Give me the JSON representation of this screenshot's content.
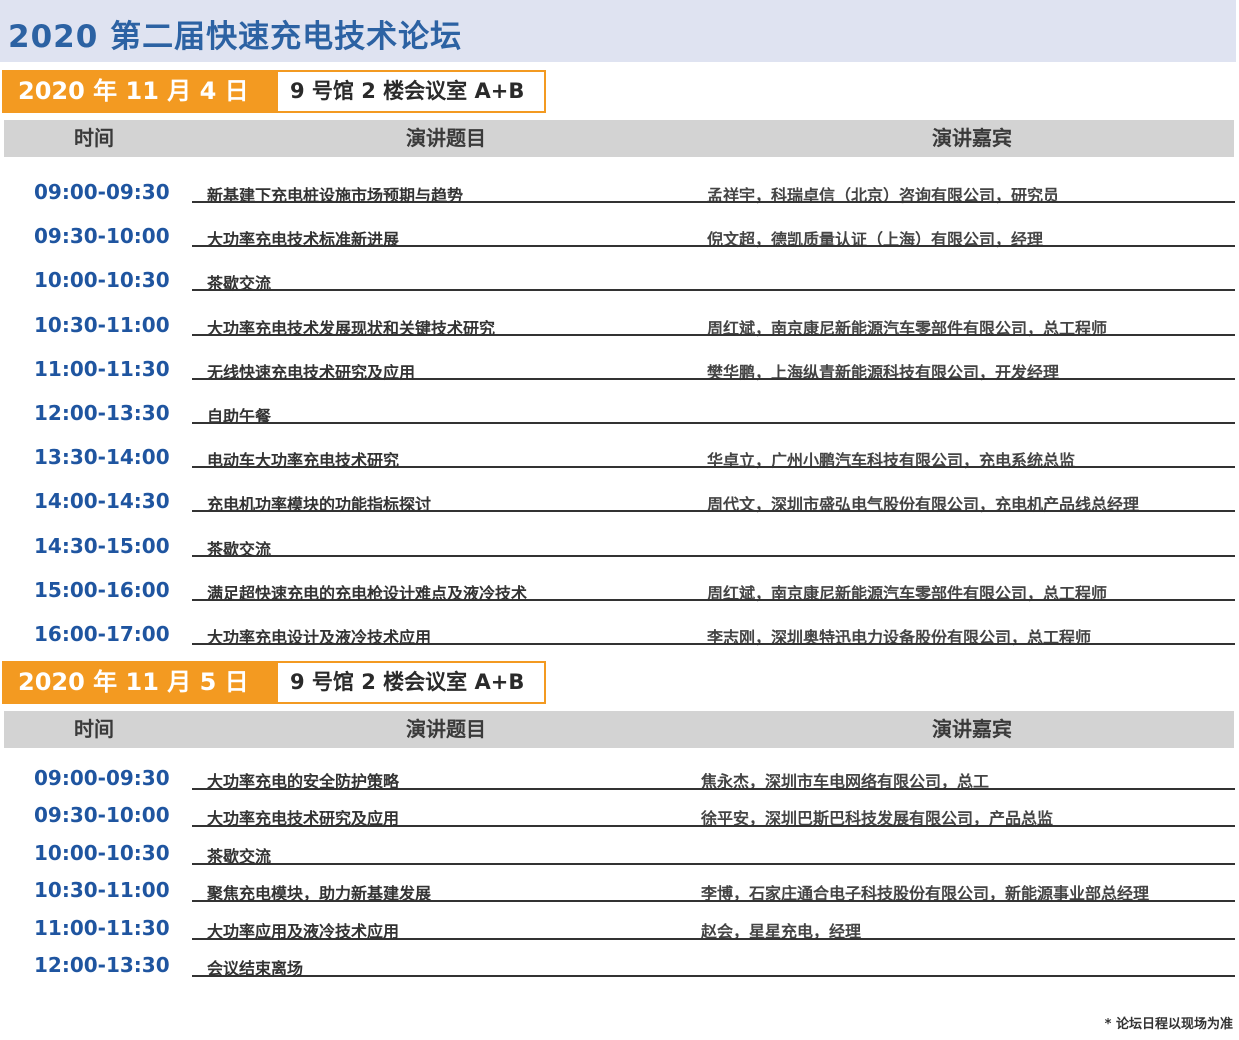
{
  "title": "2020 第二届快速充电技术论坛",
  "table_headers": {
    "time": "时间",
    "topic": "演讲题目",
    "speaker": "演讲嘉宾"
  },
  "days": [
    {
      "date": "2020 年 11 月 4 日",
      "venue": "9 号馆 2 楼会议室 A+B",
      "sessions": [
        {
          "time": "09:00-09:30",
          "topic": "新基建下充电桩设施市场预期与趋势",
          "speaker": "孟祥宇，科瑞卓信（北京）咨询有限公司，研究员"
        },
        {
          "time": "09:30-10:00",
          "topic": "大功率充电技术标准新进展",
          "speaker": "倪文超，德凯质量认证（上海）有限公司，经理"
        },
        {
          "time": "10:00-10:30",
          "topic": "茶歇交流",
          "speaker": ""
        },
        {
          "time": "10:30-11:00",
          "topic": "大功率充电技术发展现状和关键技术研究",
          "speaker": "周红斌，南京康尼新能源汽车零部件有限公司，总工程师"
        },
        {
          "time": "11:00-11:30",
          "topic": "无线快速充电技术研究及应用",
          "speaker": "樊华鹏，上海纵青新能源科技有限公司，开发经理"
        },
        {
          "time": "12:00-13:30",
          "topic": "自助午餐",
          "speaker": ""
        },
        {
          "time": "13:30-14:00",
          "topic": "电动车大功率充电技术研究",
          "speaker": "华卓立，广州小鹏汽车科技有限公司，充电系统总监"
        },
        {
          "time": "14:00-14:30",
          "topic": "充电机功率模块的功能指标探讨",
          "speaker": "周代文，深圳市盛弘电气股份有限公司，充电机产品线总经理"
        },
        {
          "time": "14:30-15:00",
          "topic": "茶歇交流",
          "speaker": ""
        },
        {
          "time": "15:00-16:00",
          "topic": "满足超快速充电的充电枪设计难点及液冷技术",
          "speaker": "周红斌，南京康尼新能源汽车零部件有限公司，总工程师"
        },
        {
          "time": "16:00-17:00",
          "topic": "大功率充电设计及液冷技术应用",
          "speaker": "李志刚，深圳奥特迅电力设备股份有限公司，总工程师"
        }
      ]
    },
    {
      "date": "2020 年 11 月 5 日",
      "venue": "9 号馆 2 楼会议室 A+B",
      "sessions": [
        {
          "time": "09:00-09:30",
          "topic": "大功率充电的安全防护策略",
          "speaker": "焦永杰，深圳市车电网络有限公司，总工"
        },
        {
          "time": "09:30-10:00",
          "topic": "大功率充电技术研究及应用",
          "speaker": "徐平安，深圳巴斯巴科技发展有限公司，产品总监"
        },
        {
          "time": "10:00-10:30",
          "topic": "茶歇交流",
          "speaker": ""
        },
        {
          "time": "10:30-11:00",
          "topic": "聚焦充电模块，助力新基建发展",
          "speaker": "李博，石家庄通合电子科技股份有限公司，新能源事业部总经理"
        },
        {
          "time": "11:00-11:30",
          "topic": "大功率应用及液冷技术应用",
          "speaker": "赵会，星星充电，经理"
        },
        {
          "time": "12:00-13:30",
          "topic": "会议结束离场",
          "speaker": ""
        }
      ]
    }
  ],
  "footnote": "* 论坛日程以现场为准"
}
